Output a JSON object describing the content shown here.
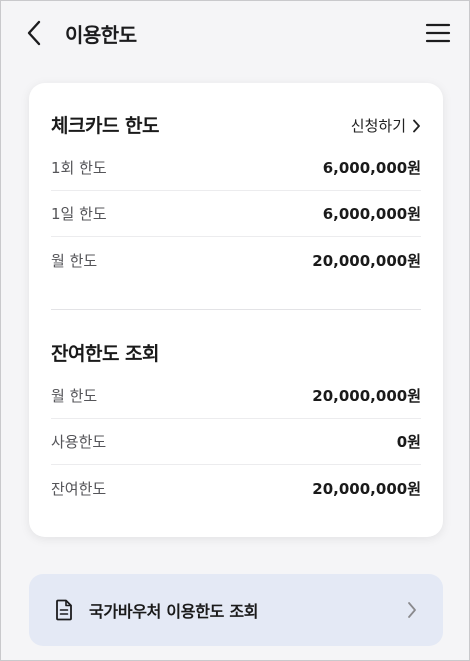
{
  "header": {
    "title": "이용한도"
  },
  "check_card": {
    "title": "체크카드 한도",
    "apply_label": "신청하기",
    "rows": [
      {
        "label": "1회 한도",
        "value": "6,000,000원"
      },
      {
        "label": "1일 한도",
        "value": "6,000,000원"
      },
      {
        "label": "월 한도",
        "value": "20,000,000원"
      }
    ]
  },
  "remaining": {
    "title": "잔여한도 조회",
    "rows": [
      {
        "label": "월 한도",
        "value": "20,000,000원"
      },
      {
        "label": "사용한도",
        "value": "0원"
      },
      {
        "label": "잔여한도",
        "value": "20,000,000원"
      }
    ]
  },
  "voucher": {
    "label": "국가바우처 이용한도 조회"
  },
  "icons": {
    "back": "chevron-left-icon",
    "menu": "hamburger-menu-icon",
    "apply_chevron": "chevron-right-icon",
    "voucher_doc": "document-icon",
    "voucher_chevron": "chevron-right-icon"
  },
  "colors": {
    "background": "#f5f5f7",
    "card": "#ffffff",
    "voucher_bg": "#e4e9f5",
    "text_primary": "#1a1a1a",
    "text_secondary": "#555559"
  }
}
